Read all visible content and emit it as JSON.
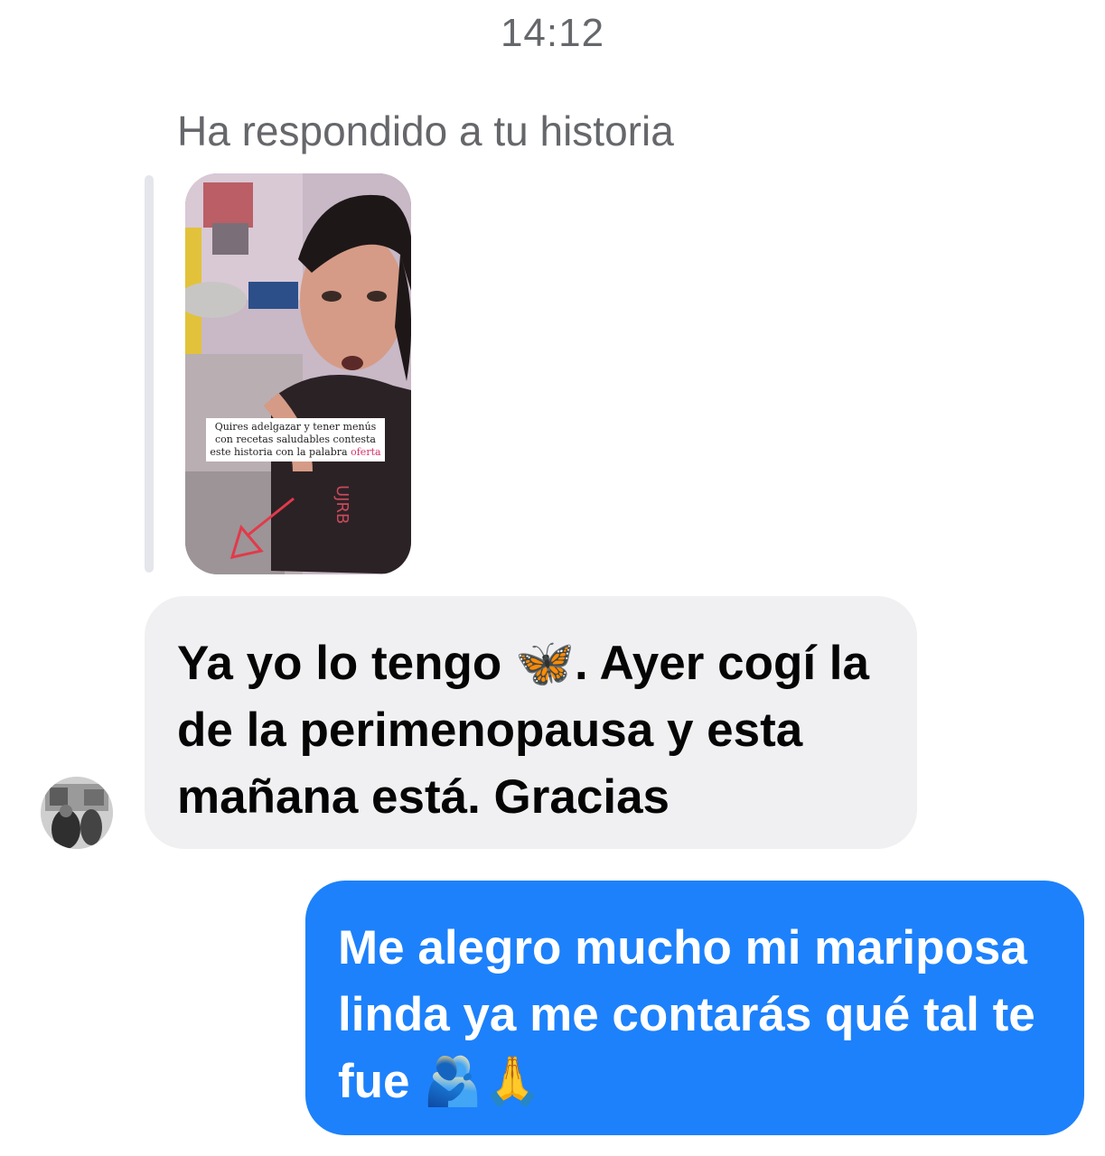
{
  "thread": {
    "timestamp": "14:12",
    "reply_label": "Ha respondido a tu historia"
  },
  "story": {
    "caption_main": "Quires adelgazar y tener menús con recetas saludables contesta este historia con la palabra",
    "caption_keyword": "oferta",
    "shirt_text": "UJRB"
  },
  "messages": [
    {
      "direction": "incoming",
      "text_part1": "Ya yo lo tengo ",
      "emoji1": "butterfly",
      "text_part2": ". Ayer cogí la de la perimenopausa y esta mañana está. Gracias"
    },
    {
      "direction": "outgoing",
      "text_part1": "Me alegro mucho mi mariposa linda ya me contarás qué tal te fue ",
      "emoji1": "people-hugging",
      "emoji2": "folded-hands"
    }
  ],
  "emoji_glyphs": {
    "butterfly": "🦋",
    "people_hugging": "🫂",
    "folded_hands": "🙏"
  },
  "colors": {
    "incoming_bubble": "#f0f0f2",
    "outgoing_bubble": "#1d81fb",
    "meta_text": "#65676b"
  }
}
